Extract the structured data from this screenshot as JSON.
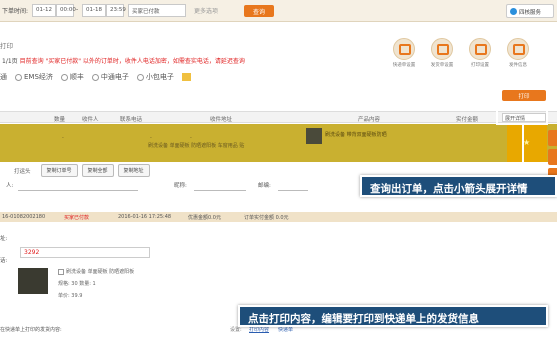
{
  "topbar": {
    "time_label": "下单时间:",
    "date_from": "01-12",
    "time_from": "00:00",
    "date_to": "01-18",
    "time_to": "23:59",
    "status_select": "买家已付款",
    "more_label": "更多选项",
    "search_button": "查询",
    "corner_button": "四核服务"
  },
  "header": {
    "title": "打印",
    "notice_prefix": "1/1页 ",
    "notice_red": "目前查询 \"买家已付款\" 以外的订单时，收件人电话加密，如需查实电话，请延迟查询",
    "carriers": [
      "通",
      "EMS经济",
      "顺丰",
      "中通电子",
      "小包电子"
    ],
    "tools": [
      "快递单设置",
      "发货单设置",
      "打印设置",
      "发件信息"
    ],
    "print_button": "打印"
  },
  "table": {
    "headers": [
      "数量",
      "收件人",
      "联系电话",
      "收件地址",
      "产品内容",
      "实付金额"
    ],
    "expand_all": "展开详情",
    "dashes": [
      "-",
      "-",
      "-"
    ],
    "product_text": "刷洗设备 带背双面硬板防晒",
    "product_sub": "刷洗设备 单面硬板 防晒遮阳板 车窗用品 贴",
    "star": "★"
  },
  "detail": {
    "label": "打运头",
    "buttons": [
      "复制订单号",
      "复制全部",
      "复制地址"
    ],
    "recv_label": "人:",
    "nickname_label": "昵称:",
    "email_label": "邮编:",
    "order_no": "16-01082002180",
    "status": "买家已付款",
    "date": "2016-01-16 17:25:48",
    "discount": "优惠金额0.0元",
    "paid": "订单实付金额 0.0元",
    "addr_label": "址:",
    "phone_label": "话:",
    "phone": "3292",
    "product_name": "刷洗设备  单面硬板 防晒遮阳板",
    "spec": "规格: 30   数量: 1",
    "price": "单价: 39.9",
    "bottom_label": "在快递单上打印的发货内容:",
    "settings_label": "设置:",
    "print_content_link": "打印内容",
    "print_content_link2": "快递单"
  },
  "callouts": {
    "expand_tip": "查询出订单，点击小箭头展开详情",
    "print_tip": "点击打印内容，编辑要打印到快递单上的发货信息"
  }
}
